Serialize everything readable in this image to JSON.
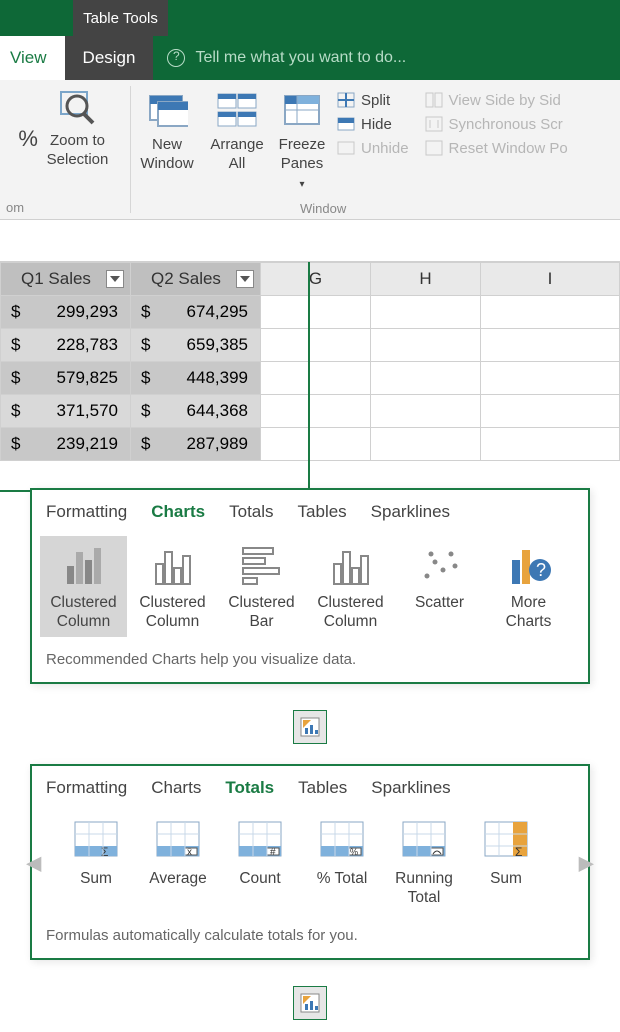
{
  "title_tabs": {
    "table_tools": "Table Tools"
  },
  "tabs": {
    "view": "View",
    "design": "Design",
    "tellme": "Tell me what you want to do..."
  },
  "ribbon": {
    "zoom_to_selection": "Zoom to\nSelection",
    "pct_suffix": "%",
    "zoom_group_suffix": "om",
    "new_window": "New\nWindow",
    "arrange_all": "Arrange\nAll",
    "freeze_panes": "Freeze\nPanes",
    "split": "Split",
    "hide": "Hide",
    "unhide": "Unhide",
    "view_side_by_side": "View Side by Sid",
    "synchronous_scrolling": "Synchronous Scr",
    "reset_window_position": "Reset Window Po",
    "window_label": "Window"
  },
  "table": {
    "headers": {
      "q1": "Q1 Sales",
      "q2": "Q2 Sales"
    },
    "col_letters": {
      "g": "G",
      "h": "H",
      "i": "I"
    },
    "rows": [
      {
        "q1": "299,293",
        "q2": "674,295"
      },
      {
        "q1": "228,783",
        "q2": "659,385"
      },
      {
        "q1": "579,825",
        "q2": "448,399"
      },
      {
        "q1": "371,570",
        "q2": "644,368"
      },
      {
        "q1": "239,219",
        "q2": "287,989"
      }
    ],
    "currency": "$"
  },
  "qa_panels": {
    "tabs": {
      "formatting": "Formatting",
      "charts": "Charts",
      "totals": "Totals",
      "tables": "Tables",
      "sparklines": "Sparklines"
    },
    "charts": {
      "items": [
        {
          "label": "Clustered\nColumn"
        },
        {
          "label": "Clustered\nColumn"
        },
        {
          "label": "Clustered\nBar"
        },
        {
          "label": "Clustered\nColumn"
        },
        {
          "label": "Scatter"
        },
        {
          "label": "More\nCharts"
        }
      ],
      "hint": "Recommended Charts help you visualize data."
    },
    "totals": {
      "items": [
        {
          "label": "Sum"
        },
        {
          "label": "Average"
        },
        {
          "label": "Count"
        },
        {
          "label": "% Total"
        },
        {
          "label": "Running\nTotal"
        },
        {
          "label": "Sum"
        }
      ],
      "hint": "Formulas automatically calculate totals for you."
    }
  }
}
